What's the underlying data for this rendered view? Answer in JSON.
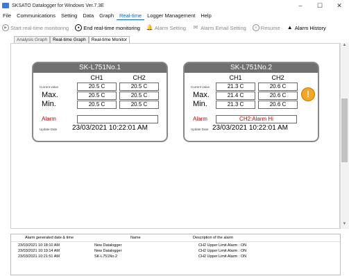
{
  "window": {
    "title": "SKSATO Datalogger for Windows Ver.7.3E",
    "minimize": "–",
    "maximize": "☐",
    "close": "✕"
  },
  "menu": [
    "File",
    "Communications",
    "Setting",
    "Data",
    "Graph",
    "Real-time",
    "Logger Management",
    "Help"
  ],
  "toolbar": {
    "start": "Start real-time monitoring",
    "end": "End real-time monitoring",
    "alarm_setting": "Alarm Setting",
    "alarm_email": "Alarm Email Setting",
    "resume": "Resume",
    "alarm_history": "Alarm History"
  },
  "tabs": [
    "Analysis Graph",
    "Real-time Graph",
    "Real-time Monitor"
  ],
  "panels": [
    {
      "name": "SK-L751No.1",
      "ch1_label": "CH1",
      "ch2_label": "CH2",
      "current_label": "Current value",
      "current": [
        "20.5 C",
        "20.5 C"
      ],
      "max_label": "Max.",
      "max": [
        "20.5 C",
        "20.5 C"
      ],
      "min_label": "Min.",
      "min": [
        "20.5 C",
        "20.5 C"
      ],
      "alarm_label": "Alarm",
      "alarm": "",
      "update_label": "Update Date",
      "update": "23/03/2021 10:22:01 AM"
    },
    {
      "name": "SK-L751No.2",
      "ch1_label": "CH1",
      "ch2_label": "CH2",
      "current_label": "Current value",
      "current": [
        "21.3 C",
        "20.6 C"
      ],
      "max_label": "Max.",
      "max": [
        "21.4 C",
        "20.6 C"
      ],
      "min_label": "Min.",
      "min": [
        "21.3 C",
        "20.6 C"
      ],
      "alarm_label": "Alarm",
      "alarm": "CH2:Alarm Hi",
      "update_label": "Update Date",
      "update": "23/03/2021 10:22:01 AM",
      "warning_glyph": "!"
    }
  ],
  "history": {
    "headers": [
      "Alarm generated date & time",
      "Name",
      "Description of the alarm"
    ],
    "rows": [
      [
        "23/03/2021 10:18:10 AM",
        "New Datalogger",
        "CH2 Upper Limit Alarm : ON"
      ],
      [
        "23/03/2021 10:19:14 AM",
        "New Datalogger",
        "CH2 Upper Limit Alarm : ON"
      ],
      [
        "23/03/2021 10:21:51 AM",
        "SK-L751No.2",
        "CH2 Upper Limit Alarm : ON"
      ]
    ]
  }
}
